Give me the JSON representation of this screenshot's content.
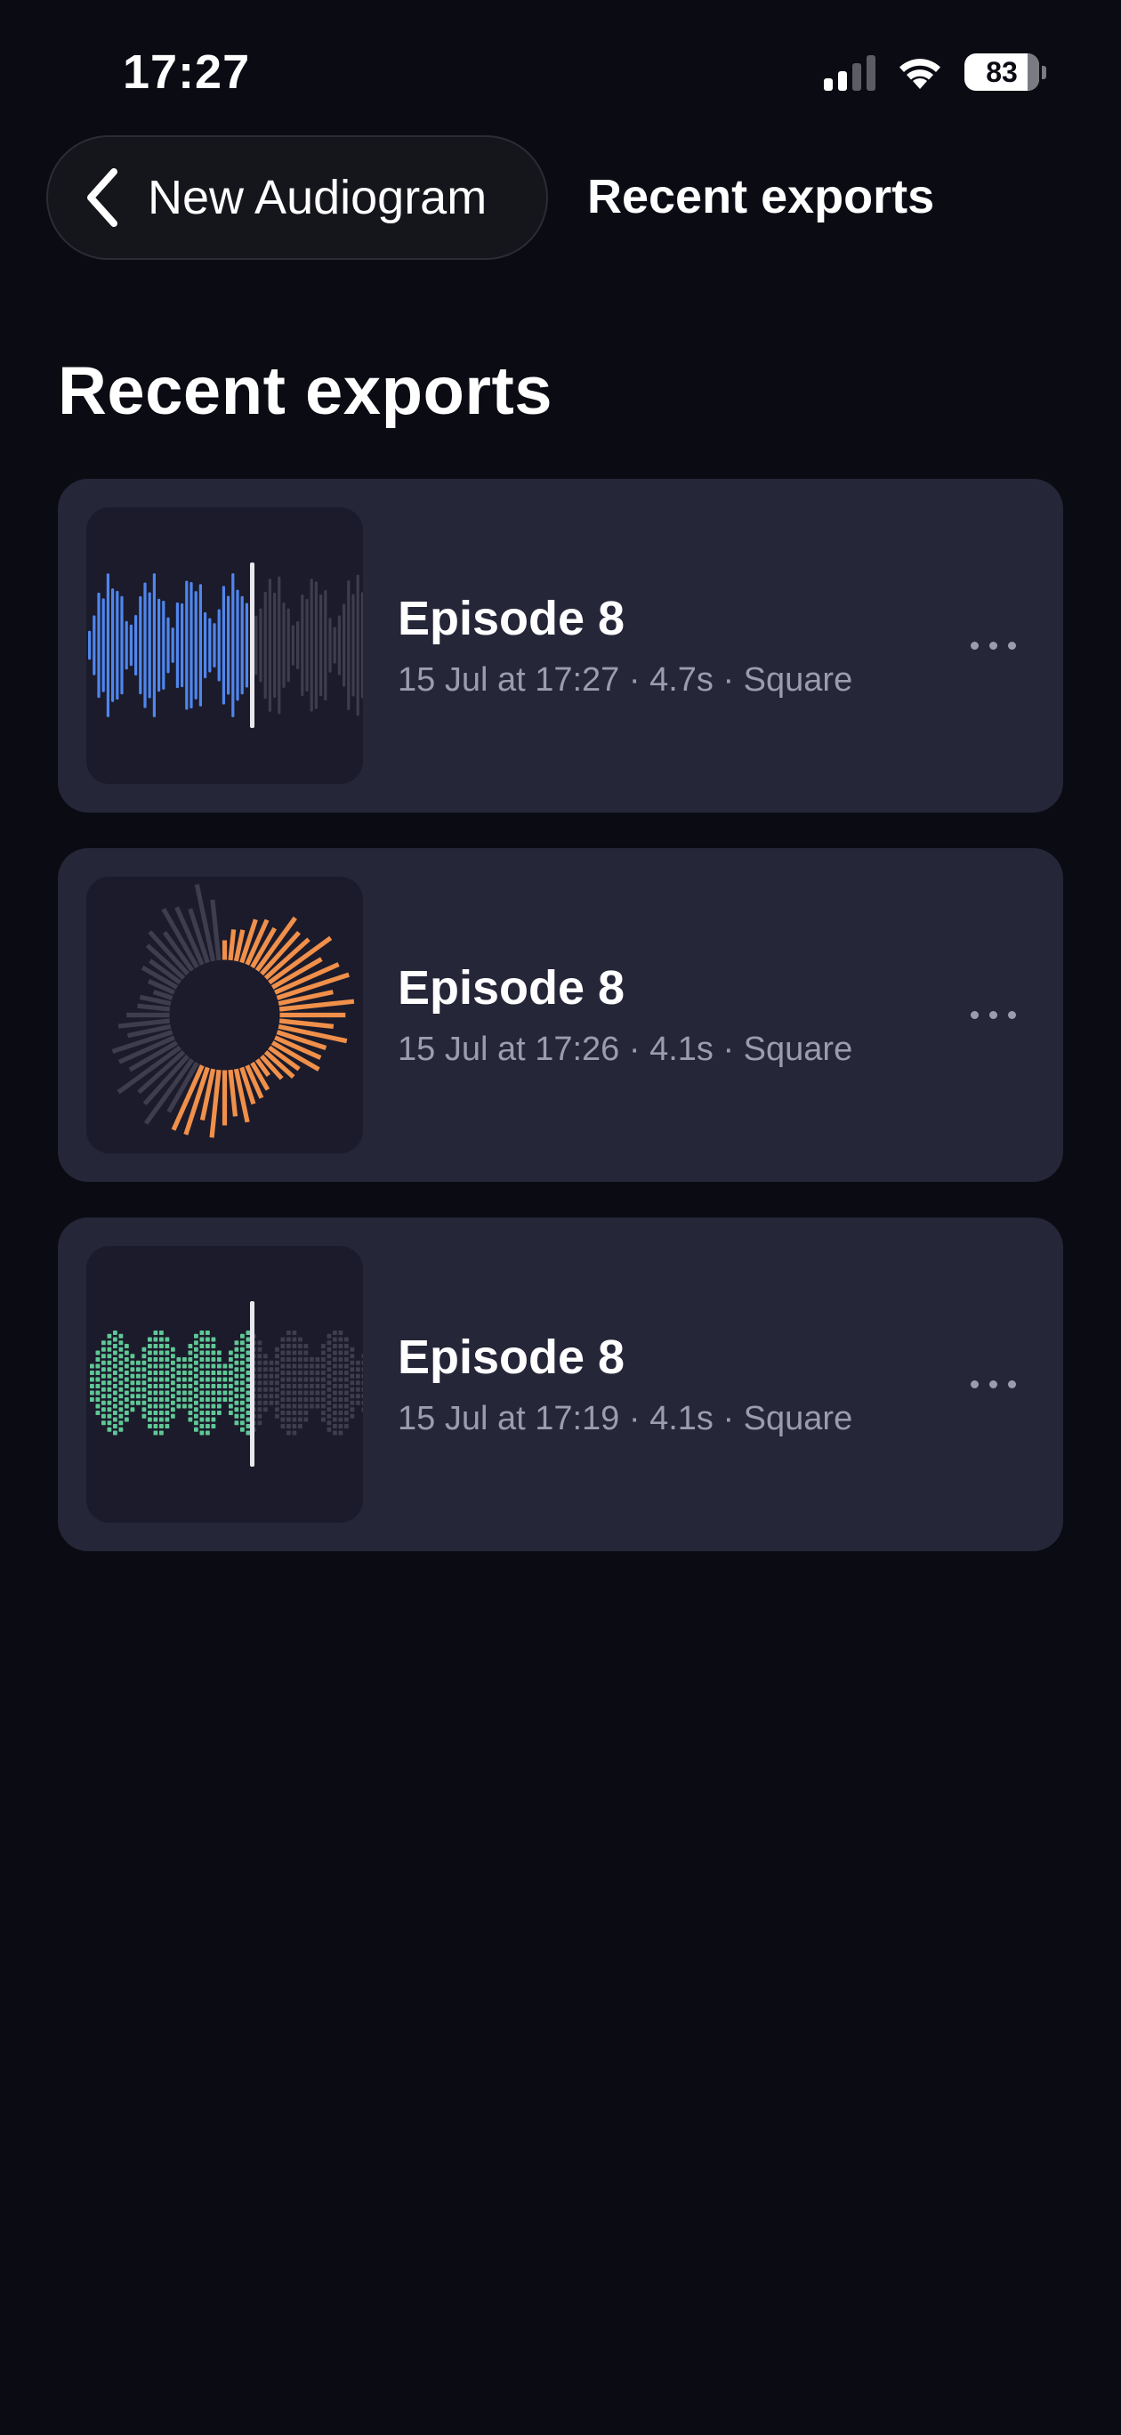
{
  "status_bar": {
    "time": "17:27",
    "battery": "83"
  },
  "nav": {
    "back_label": "New Audiogram",
    "title": "Recent exports"
  },
  "page": {
    "title": "Recent exports"
  },
  "exports": [
    {
      "title": "Episode 8",
      "meta": "15 Jul at 17:27 · 4.7s · Square",
      "style": "waveform-bars",
      "accent": "#4f86ee"
    },
    {
      "title": "Episode 8",
      "meta": "15 Jul at 17:26 · 4.1s · Square",
      "style": "radial",
      "accent": "#f0904a"
    },
    {
      "title": "Episode 8",
      "meta": "15 Jul at 17:19 · 4.1s · Square",
      "style": "segmented-bars",
      "accent": "#5fc896"
    }
  ],
  "colors": {
    "background": "#0b0b14",
    "card": "#262639",
    "thumb": "#1b1b2b",
    "inactive_wave": "#3d3d4d",
    "meta_text": "#9c9cae"
  }
}
